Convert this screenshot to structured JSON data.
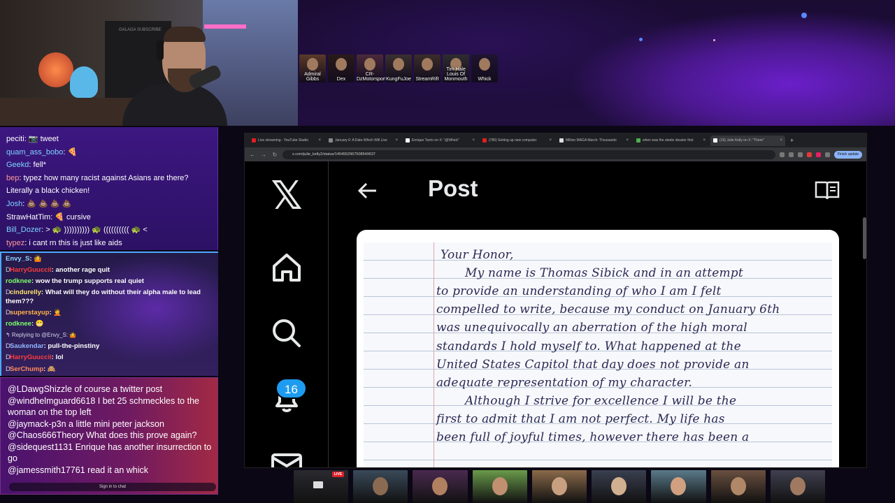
{
  "banner": {
    "webcam_sign": "GALAGA SUBSCRIBE",
    "avatars": [
      {
        "label": "Admiral Gibbs",
        "bg": "#5a3a2a"
      },
      {
        "label": "Dex",
        "bg": "#2a1a1a"
      },
      {
        "label": "CR-DzMotorsports",
        "bg": "#4a2a3a"
      },
      {
        "label": "KungFuJoe",
        "bg": "#3a3030"
      },
      {
        "label": "StreamRift",
        "bg": "#3a2c2a"
      },
      {
        "label": "Tim Hale Louis Of Monmouth",
        "bg": "#2e2c30"
      },
      {
        "label": "Whick",
        "bg": "#1e1430"
      }
    ]
  },
  "chat_main": {
    "messages": [
      {
        "user": "peciti",
        "color": "#ffffff",
        "text": "📷 tweet"
      },
      {
        "user": "quam_ass_bobo",
        "color": "#7fd4ff",
        "text": "🍕"
      },
      {
        "user": "Geekd",
        "color": "#7fd4ff",
        "text": "fell*"
      },
      {
        "user": "bep",
        "color": "#ff9a9a",
        "text": "typez how many racist against Asians are there?"
      },
      {
        "user": "",
        "color": "#ffffff",
        "text": "Literally a black chicken!"
      },
      {
        "user": "Josh",
        "color": "#7fd4ff",
        "text": "💩 💩 💩 💩"
      },
      {
        "user": "StrawHatTim",
        "color": "#ffffff",
        "text": "🍕 cursive"
      },
      {
        "user": "Bill_Dozer",
        "color": "#7fd4ff",
        "text": "> 🐢 )))))))))) 🐢 (((((((((( 🐢 <"
      },
      {
        "user": "typez",
        "color": "#ff9a9a",
        "text": "i cant rn this is just like aids"
      }
    ]
  },
  "chat_secondary": {
    "messages": [
      {
        "badge": "",
        "user": "Envy_S",
        "color": "#8fd4ff",
        "text": "🤷",
        "kind": "line"
      },
      {
        "badge": "D",
        "user": "HarryGuuccii",
        "color": "#ff3b3b",
        "text": "another rage quit",
        "kind": "line"
      },
      {
        "badge": "",
        "user": "rodknee",
        "color": "#7dff6a",
        "text": "wow the trump supports real quiet",
        "kind": "line"
      },
      {
        "badge": "D",
        "user": "cindurelly",
        "color": "#ffe36a",
        "text": "What will they do without their alpha male to lead them???",
        "kind": "wrap"
      },
      {
        "badge": "D",
        "user": "superstayup",
        "color": "#ffb347",
        "text": "🤦",
        "kind": "line"
      },
      {
        "badge": "",
        "user": "rodknee",
        "color": "#7dff6a",
        "text": "😬",
        "kind": "line"
      },
      {
        "badge": "",
        "user": "",
        "color": "#ffffff",
        "text": "↰ Replying to @Envy_S: 🤷",
        "kind": "reply"
      },
      {
        "badge": "D",
        "user": "Saukendar",
        "color": "#8fb8ff",
        "text": "pull-the-pinstiny",
        "kind": "line"
      },
      {
        "badge": "D",
        "user": "HarryGuuccii",
        "color": "#ff3b3b",
        "text": "lol",
        "kind": "line"
      },
      {
        "badge": "D",
        "user": "SerChump",
        "color": "#ff8a5a",
        "text": "🙈",
        "kind": "line"
      }
    ]
  },
  "chat_youtube": {
    "messages": [
      {
        "user": "@LDawgShizzle",
        "text": "of course a twitter post"
      },
      {
        "user": "@windhelmguard6618",
        "text": "I bet 25 schmeckles to the woman on the top left"
      },
      {
        "user": "@jaymack-p3n",
        "text": "a little mini peter jackson"
      },
      {
        "user": "@Chaos666Theory",
        "text": "What does this prove again?"
      },
      {
        "user": "@sidequest1131",
        "text": "Enrique has another insurrection to go"
      },
      {
        "user": "@jamessmith17761",
        "text": "read it an whick"
      }
    ],
    "signin_label": "Sign in to chat"
  },
  "browser": {
    "tabs": [
      {
        "title": "Live streaming - YouTube Studio",
        "fav": "#e02020",
        "active": false
      },
      {
        "title": "January 6: A Date Which Will Live",
        "fav": "#888888",
        "active": false
      },
      {
        "title": "Enrique Tarrio on X: \"@Whick\"",
        "fav": "#ffffff",
        "active": false
      },
      {
        "title": "(785) Setting up new computer",
        "fav": "#e02020",
        "active": false
      },
      {
        "title": "Million MAGA March: Thousands",
        "fav": "#dddddd",
        "active": false
      },
      {
        "title": "when was the steele dossier first",
        "fav": "#4caf50",
        "active": false
      },
      {
        "title": "(16) Julie Kelly on X: \"There\"",
        "fav": "#ffffff",
        "active": true
      }
    ],
    "url": "x.com/julie_kelly2/status/1454552967508549637",
    "refresh_label": "Finish update"
  },
  "x_app": {
    "logo": "𝕏",
    "title": "Post",
    "notification_count": "16",
    "accent": "#1d9bf0"
  },
  "letter": {
    "lines": [
      "Your Honor,",
      "My name is Thomas Sibick and in an attempt",
      "to provide an understanding of who I am I felt",
      "compelled to write, because my conduct on January 6th",
      "was unequivocally an aberration of the high moral",
      "standards I hold myself to. What happened at the",
      "United States Capitol that day does not provide an",
      "adequate representation of my character.",
      "Although I strive for excellence I will be the",
      "first to admit that I am not perfect. My life has",
      "been full of joyful times, however there has been a"
    ]
  },
  "thumbnails": {
    "live_label": "LIVE",
    "items": [
      {
        "bg": "#2a2a30",
        "face": "#444"
      },
      {
        "bg": "#3a4a5a",
        "face": "#8a6a50"
      },
      {
        "bg": "#4a2a50",
        "face": "#b08060"
      },
      {
        "bg": "#6a9a4a",
        "face": "#c09070"
      },
      {
        "bg": "#8a6a4a",
        "face": "#c8a080"
      },
      {
        "bg": "#3a4050",
        "face": "#d0b090"
      },
      {
        "bg": "#5a7a8a",
        "face": "#d0a080"
      },
      {
        "bg": "#6a5040",
        "face": "#b08868"
      },
      {
        "bg": "#404050",
        "face": "#a07a60"
      }
    ]
  }
}
